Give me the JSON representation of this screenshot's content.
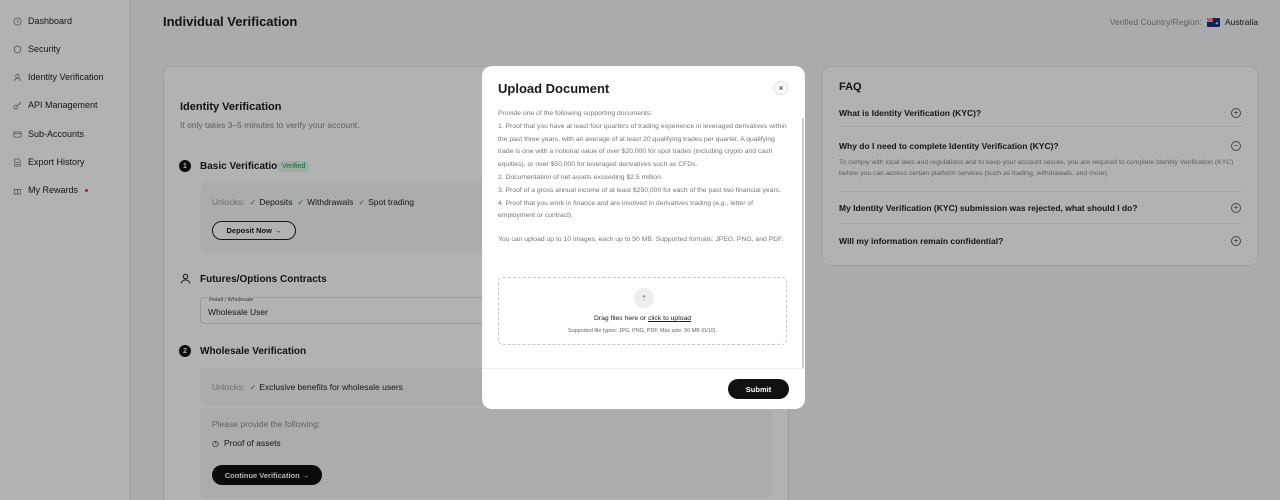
{
  "sidebar": {
    "items": [
      {
        "label": "Dashboard",
        "icon": "clock-icon"
      },
      {
        "label": "Security",
        "icon": "shield-icon"
      },
      {
        "label": "Identity Verification",
        "icon": "user-icon"
      },
      {
        "label": "API Management",
        "icon": "key-icon"
      },
      {
        "label": "Sub-Accounts",
        "icon": "accounts-icon"
      },
      {
        "label": "Export History",
        "icon": "document-icon"
      },
      {
        "label": "My Rewards",
        "icon": "gift-icon"
      }
    ]
  },
  "header": {
    "title": "Individual Verification",
    "region_label": "Verified Country/Region:",
    "region_value": "Australia"
  },
  "main": {
    "title": "Identity Verification",
    "subtitle": "It only takes 3–5 minutes to verify your account.",
    "basic": {
      "step": "1",
      "title": "Basic Verification",
      "badge": "Verified",
      "unlocks_label": "Unlocks:",
      "unlocks": [
        "Deposits",
        "Withdrawals",
        "Spot trading"
      ],
      "button": "Deposit Now →"
    },
    "futures": {
      "title": "Futures/Options Contracts",
      "field_label": "Retail / Wholesale",
      "field_value": "Wholesale User"
    },
    "wholesale": {
      "step": "2",
      "title": "Wholesale Verification",
      "unlocks_label": "Unlocks:",
      "unlocks": [
        "Exclusive benefits for wholesale users"
      ],
      "provide_label": "Please provide the following:",
      "item": "Proof of assets",
      "button": "Continue Verification →"
    }
  },
  "faq": {
    "title": "FAQ",
    "items": [
      {
        "q": "What is Identity Verification (KYC)?",
        "icon": "plus"
      },
      {
        "q": "Why do I need to complete Identity Verification (KYC)?",
        "icon": "minus",
        "a": "To comply with local laws and regulations and to keep your account secure, you are required to complete Identity Verification (KYC) before you can access certain platform services (such as trading, withdrawals, and more)."
      },
      {
        "q": "My Identity Verification (KYC) submission was rejected, what should I do?",
        "icon": "plus"
      },
      {
        "q": "Will my information remain confidential?",
        "icon": "plus"
      }
    ]
  },
  "modal": {
    "title": "Upload Document",
    "close": "×",
    "intro": "Provide one of the following supporting documents:",
    "items": [
      "1. Proof that you have at least four quarters of trading experience in leveraged derivatives within the past three years, with an average of at least 20 qualifying trades per quarter. A qualifying trade is one with a notional value of over $20,000 for spot trades (including crypto and cash equities), or over $50,000 for leveraged derivatives such as CFDs.",
      "2. Documentation of net assets exceeding $2.5 million.",
      "3. Proof of a gross annual income of at least $250,000 for each of the past two financial years.",
      "4. Proof that you work in finance and are involved in derivatives trading (e.g., letter of employment or contract)."
    ],
    "upload_note": "You can upload up to 10 images, each up to 50 MB. Supported formats: JPEG, PNG, and PDF.",
    "drop_prefix": "Drag files here or ",
    "drop_link": "click to upload",
    "drop_sub": "Supported file types: JPG, PNG, PDF. Max size: 50 MB (0/10).",
    "submit": "Submit"
  }
}
